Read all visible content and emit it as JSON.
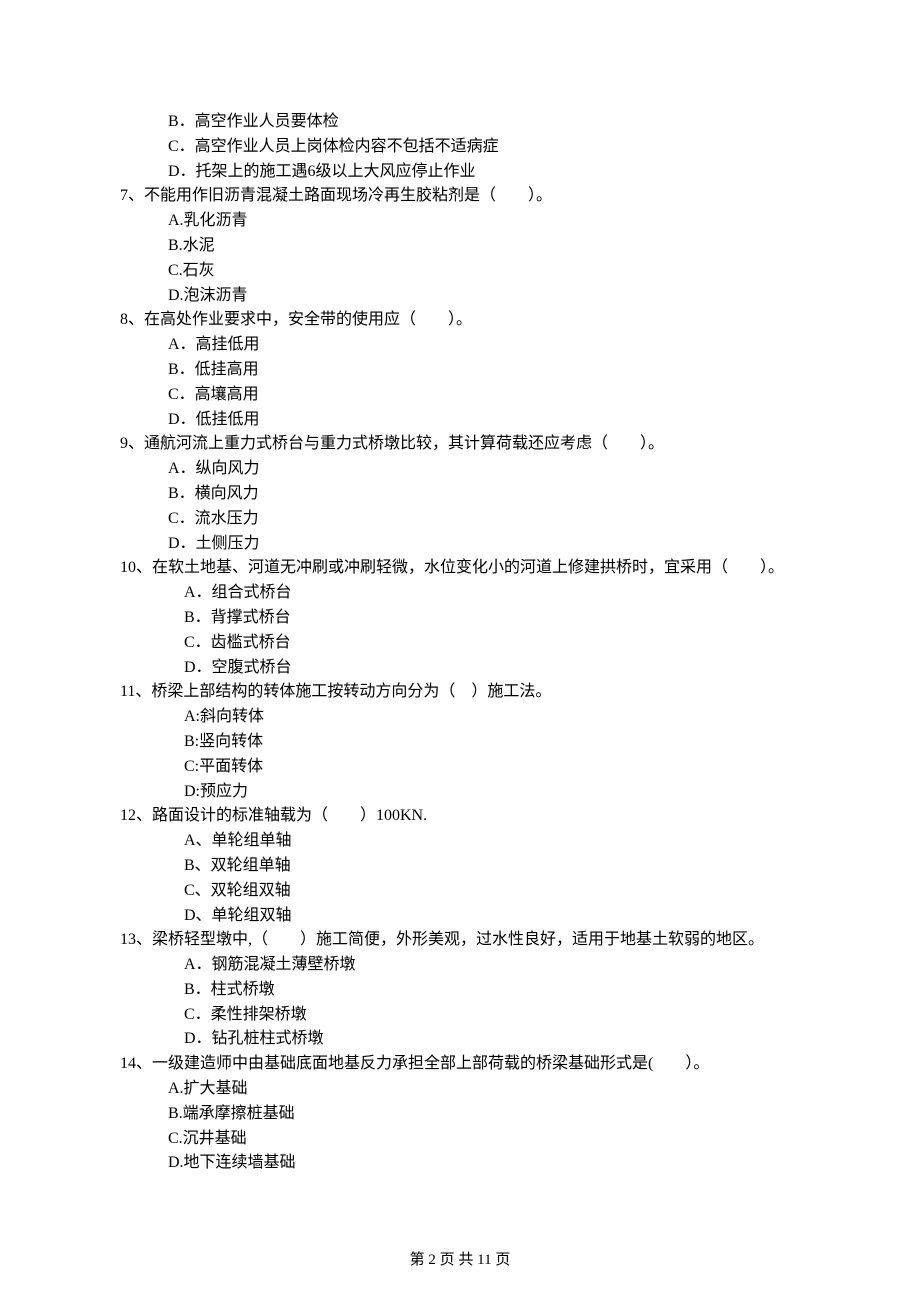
{
  "lines": [
    {
      "indent": 2,
      "text": "B．高空作业人员要体检"
    },
    {
      "indent": 2,
      "text": "C．高空作业人员上岗体检内容不包括不适病症"
    },
    {
      "indent": 2,
      "text": "D．托架上的施工遇6级以上大风应停止作业"
    },
    {
      "indent": 1,
      "text": "7、不能用作旧沥青混凝土路面现场冷再生胶粘剂是（　　）。"
    },
    {
      "indent": 2,
      "text": "A.乳化沥青"
    },
    {
      "indent": 2,
      "text": "B.水泥"
    },
    {
      "indent": 2,
      "text": "C.石灰"
    },
    {
      "indent": 2,
      "text": "D.泡沫沥青"
    },
    {
      "indent": 1,
      "text": "8、在高处作业要求中，安全带的使用应（　　）。"
    },
    {
      "indent": 2,
      "text": "A．高挂低用"
    },
    {
      "indent": 2,
      "text": "B．低挂高用"
    },
    {
      "indent": 2,
      "text": "C．高壤高用"
    },
    {
      "indent": 2,
      "text": "D．低挂低用"
    },
    {
      "indent": 1,
      "text": "9、通航河流上重力式桥台与重力式桥墩比较，其计算荷载还应考虑（　　）。"
    },
    {
      "indent": 2,
      "text": "A．纵向风力"
    },
    {
      "indent": 2,
      "text": "B．横向风力"
    },
    {
      "indent": 2,
      "text": "C．流水压力"
    },
    {
      "indent": 2,
      "text": "D．土侧压力"
    },
    {
      "indent": 1,
      "text": "10、在软土地基、河道无冲刷或冲刷轻微，水位变化小的河道上修建拱桥时，宜采用（　　）。"
    },
    {
      "indent": 3,
      "text": "A．组合式桥台"
    },
    {
      "indent": 3,
      "text": "B．背撑式桥台"
    },
    {
      "indent": 3,
      "text": "C．齿槛式桥台"
    },
    {
      "indent": 3,
      "text": "D．空腹式桥台"
    },
    {
      "indent": 1,
      "text": "11、桥梁上部结构的转体施工按转动方向分为（　）施工法。"
    },
    {
      "indent": 3,
      "text": "A:斜向转体"
    },
    {
      "indent": 3,
      "text": "B:竖向转体"
    },
    {
      "indent": 3,
      "text": "C:平面转体"
    },
    {
      "indent": 3,
      "text": "D:预应力"
    },
    {
      "indent": 1,
      "text": "12、路面设计的标准轴载为（　　）100KN."
    },
    {
      "indent": 3,
      "text": "A、单轮组单轴"
    },
    {
      "indent": 3,
      "text": "B、双轮组单轴"
    },
    {
      "indent": 3,
      "text": "C、双轮组双轴"
    },
    {
      "indent": 3,
      "text": "D、单轮组双轴"
    },
    {
      "indent": 1,
      "text": "13、梁桥轻型墩中,（　　）施工简便，外形美观，过水性良好，适用于地基土软弱的地区。"
    },
    {
      "indent": 3,
      "text": "A．钢筋混凝土薄壁桥墩"
    },
    {
      "indent": 3,
      "text": "B．柱式桥墩"
    },
    {
      "indent": 3,
      "text": "C．柔性排架桥墩"
    },
    {
      "indent": 3,
      "text": "D．钻孔桩柱式桥墩"
    },
    {
      "indent": 1,
      "text": "14、一级建造师中由基础底面地基反力承担全部上部荷载的桥梁基础形式是(　　）。"
    },
    {
      "indent": 2,
      "text": "A.扩大基础"
    },
    {
      "indent": 2,
      "text": "B.端承摩擦桩基础"
    },
    {
      "indent": 2,
      "text": "C.沉井基础"
    },
    {
      "indent": 2,
      "text": "D.地下连续墙基础"
    }
  ],
  "footer": "第 2 页 共 11 页"
}
